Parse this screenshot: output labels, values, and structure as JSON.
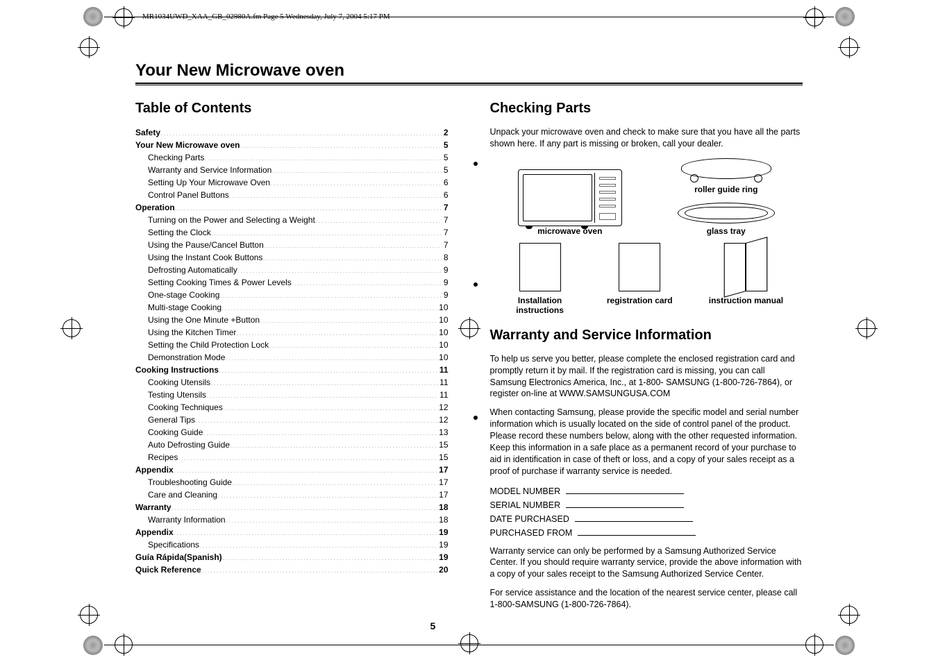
{
  "header_line": "MR1034UWD_XAA_GB_02980A.fm  Page 5  Wednesday, July 7, 2004  5:17 PM",
  "main_title": "Your New Microwave oven",
  "page_number": "5",
  "toc": {
    "title": "Table of Contents",
    "items": [
      {
        "label": "Safety",
        "page": "2",
        "bold": true,
        "sub": false
      },
      {
        "label": "Your New Microwave oven",
        "page": "5",
        "bold": true,
        "sub": false
      },
      {
        "label": "Checking Parts",
        "page": "5",
        "bold": false,
        "sub": true
      },
      {
        "label": "Warranty and Service Information",
        "page": "5",
        "bold": false,
        "sub": true
      },
      {
        "label": "Setting Up Your Microwave Oven",
        "page": "6",
        "bold": false,
        "sub": true
      },
      {
        "label": "Control Panel Buttons",
        "page": "6",
        "bold": false,
        "sub": true
      },
      {
        "label": "Operation",
        "page": "7",
        "bold": true,
        "sub": false
      },
      {
        "label": "Turning on the Power and Selecting a Weight",
        "page": "7",
        "bold": false,
        "sub": true
      },
      {
        "label": "Setting the Clock",
        "page": "7",
        "bold": false,
        "sub": true
      },
      {
        "label": "Using the Pause/Cancel Button",
        "page": "7",
        "bold": false,
        "sub": true
      },
      {
        "label": "Using the Instant Cook Buttons",
        "page": "8",
        "bold": false,
        "sub": true
      },
      {
        "label": "Defrosting Automatically",
        "page": "9",
        "bold": false,
        "sub": true
      },
      {
        "label": "Setting Cooking Times & Power Levels",
        "page": "9",
        "bold": false,
        "sub": true
      },
      {
        "label": "One-stage Cooking",
        "page": "9",
        "bold": false,
        "sub": true
      },
      {
        "label": "Multi-stage Cooking",
        "page": "10",
        "bold": false,
        "sub": true
      },
      {
        "label": "Using the One Minute +Button",
        "page": "10",
        "bold": false,
        "sub": true
      },
      {
        "label": "Using the Kitchen Timer",
        "page": "10",
        "bold": false,
        "sub": true
      },
      {
        "label": "Setting the Child Protection Lock",
        "page": "10",
        "bold": false,
        "sub": true
      },
      {
        "label": "Demonstration Mode",
        "page": "10",
        "bold": false,
        "sub": true
      },
      {
        "label": "Cooking Instructions",
        "page": "11",
        "bold": true,
        "sub": false
      },
      {
        "label": "Cooking Utensils",
        "page": "11",
        "bold": false,
        "sub": true
      },
      {
        "label": "Testing Utensils",
        "page": "11",
        "bold": false,
        "sub": true
      },
      {
        "label": "Cooking Techniques",
        "page": "12",
        "bold": false,
        "sub": true
      },
      {
        "label": "General Tips",
        "page": "12",
        "bold": false,
        "sub": true
      },
      {
        "label": "Cooking Guide",
        "page": "13",
        "bold": false,
        "sub": true
      },
      {
        "label": "Auto Defrosting Guide",
        "page": "15",
        "bold": false,
        "sub": true
      },
      {
        "label": "Recipes",
        "page": "15",
        "bold": false,
        "sub": true
      },
      {
        "label": "Appendix",
        "page": "17",
        "bold": true,
        "sub": false
      },
      {
        "label": "Troubleshooting Guide",
        "page": "17",
        "bold": false,
        "sub": true
      },
      {
        "label": "Care and Cleaning",
        "page": "17",
        "bold": false,
        "sub": true
      },
      {
        "label": "Warranty",
        "page": "18",
        "bold": true,
        "sub": false
      },
      {
        "label": "Warranty Information",
        "page": "18",
        "bold": false,
        "sub": true
      },
      {
        "label": "Appendix",
        "page": "19",
        "bold": true,
        "sub": false
      },
      {
        "label": "Specifications",
        "page": "19",
        "bold": false,
        "sub": true
      },
      {
        "label": "Guía Rápida(Spanish)",
        "page": "19",
        "bold": true,
        "sub": false
      },
      {
        "label": "Quick Reference",
        "page": "20",
        "bold": true,
        "sub": false
      }
    ]
  },
  "checking": {
    "title": "Checking Parts",
    "intro": "Unpack your microwave oven and check to make sure that you have all the parts shown here. If any part is missing or broken, call your dealer.",
    "parts": {
      "microwave": "microwave oven",
      "roller": "roller guide ring",
      "tray": "glass tray",
      "install": "Installation instructions",
      "regcard": "registration card",
      "manual": "instruction manual"
    }
  },
  "warranty": {
    "title": "Warranty and Service Information",
    "p1": "To help us serve you better, please complete the enclosed registration card and promptly return it by mail. If the registration card is missing, you can call Samsung Electronics America, Inc., at 1-800- SAMSUNG (1-800-726-7864), or register on-line at WWW.SAMSUNGUSA.COM",
    "p2": "When contacting Samsung, please provide the specific model and serial number information which is usually located on the side of control panel of the product. Please record these numbers below, along with the other requested information. Keep this information in a safe place as a permanent record of your purchase to aid in identification in case of theft or loss, and a copy of your sales receipt as a proof of purchase if warranty service is needed.",
    "fields": {
      "model": "MODEL NUMBER",
      "serial": "SERIAL NUMBER",
      "date": "DATE PURCHASED",
      "from": "PURCHASED FROM"
    },
    "p3": "Warranty service can only be performed by a Samsung Authorized Service Center. If you should require warranty service, provide the above information with a copy of your sales receipt to the Samsung Authorized Service Center.",
    "p4": "For service assistance and the location of the nearest service center, please call 1-800-SAMSUNG (1-800-726-7864)."
  }
}
